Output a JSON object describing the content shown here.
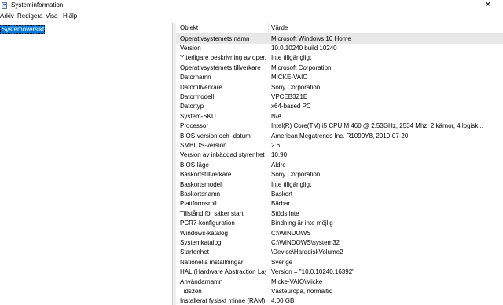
{
  "window": {
    "title": "Systeminformation"
  },
  "menu": [
    "Arkiv",
    "Redigera",
    "Visa",
    "Hjälp"
  ],
  "tree": {
    "selected": "Systemöversikt"
  },
  "table": {
    "headers": [
      "Objekt",
      "Värde"
    ],
    "rows": [
      [
        "Operativsystemets namn",
        "Microsoft Windows 10 Home"
      ],
      [
        "Version",
        "10.0.10240 build 10240"
      ],
      [
        "Ytterligare beskrivning av oper...",
        "Inte tillgängligt"
      ],
      [
        "Operativsystemets tillverkare",
        "Microsoft Corporation"
      ],
      [
        "Datornamn",
        "MICKE-VAIO"
      ],
      [
        "Datortillverkare",
        "Sony Corporation"
      ],
      [
        "Datormodell",
        "VPCEB3Z1E"
      ],
      [
        "Datortyp",
        "x64-based PC"
      ],
      [
        "System-SKU",
        "N/A"
      ],
      [
        "Processor",
        "Intel(R) Core(TM) i5 CPU       M 460  @ 2.53GHz, 2534 Mhz, 2 kärnor, 4 logisk..."
      ],
      [
        "BIOS-version och -datum",
        "American Megatrends Inc. R1090Y8, 2010-07-20"
      ],
      [
        "SMBIOS-version",
        "2.6"
      ],
      [
        "Version av inbäddad styrenhet",
        "10.90"
      ],
      [
        "BIOS-läge",
        "Äldre"
      ],
      [
        "Baskortstillverkare",
        "Sony Corporation"
      ],
      [
        "Baskortsmodell",
        "Inte tillgängligt"
      ],
      [
        "Baskortsnamn",
        "Baskort"
      ],
      [
        "Plattformsroll",
        "Bärbar"
      ],
      [
        "Tillstånd för säker start",
        "Stöds inte"
      ],
      [
        "PCR7-konfiguration",
        "Bindning är inte möjlig"
      ],
      [
        "Windows-katalog",
        "C:\\WINDOWS"
      ],
      [
        "Systemkatalog",
        "C:\\WINDOWS\\system32"
      ],
      [
        "Startenhet",
        "\\Device\\HarddiskVolume2"
      ],
      [
        "Nationella inställningar",
        "Sverige"
      ],
      [
        "HAL (Hardware Abstraction Lay...",
        "Version = \"10.0.10240.16392\""
      ],
      [
        "Användarnamn",
        "Micke-VAIO\\Micke"
      ],
      [
        "Tidszon",
        "Västeuropa, normaltid"
      ],
      [
        "Installerat fysiskt minne (RAM)",
        "4,00 GB"
      ]
    ]
  }
}
